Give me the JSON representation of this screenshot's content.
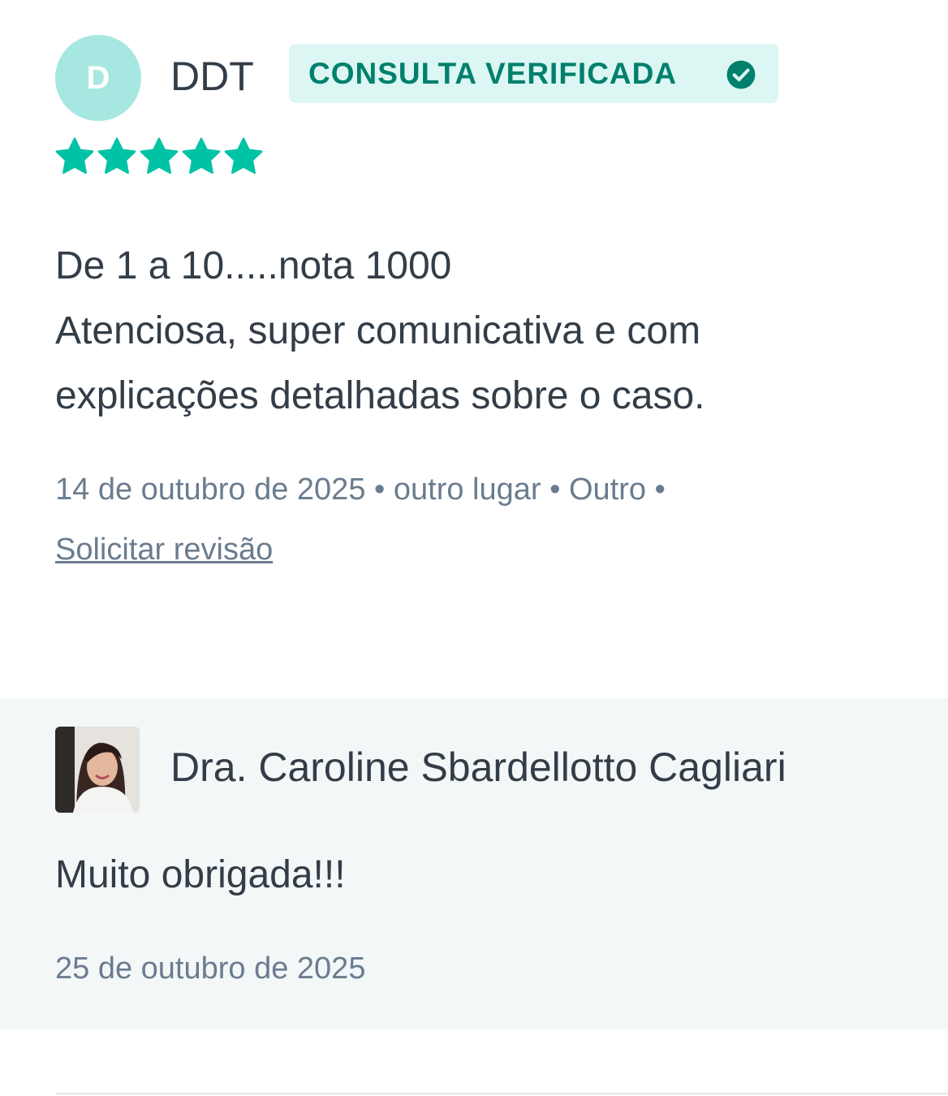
{
  "review": {
    "avatar_initial": "D",
    "author": "DDT",
    "badge_label": "CONSULTA VERIFICADA",
    "rating": 5,
    "rating_max": 5,
    "text": "De 1 a 10.....nota 1000\nAtenciosa, super comunicativa e com\nexplicações detalhadas sobre o caso.",
    "meta": "14 de outubro de 2025 • outro lugar • Outro •",
    "request_review_link": "Solicitar revisão"
  },
  "reply": {
    "doctor_name": "Dra. Caroline Sbardellotto Cagliari",
    "text": "Muito obrigada!!!",
    "date": "25 de outubro de 2025"
  },
  "colors": {
    "accent": "#00c3a5",
    "badge_bg": "#dcf7f3",
    "badge_text": "#00806d",
    "avatar_bg": "#a6e8e1",
    "reply_bg": "#f3f7f8",
    "muted_text": "#6b7c8f",
    "body_text": "#333d47"
  },
  "icons": {
    "badge": "check-circle-icon",
    "rating": "star-icon"
  }
}
